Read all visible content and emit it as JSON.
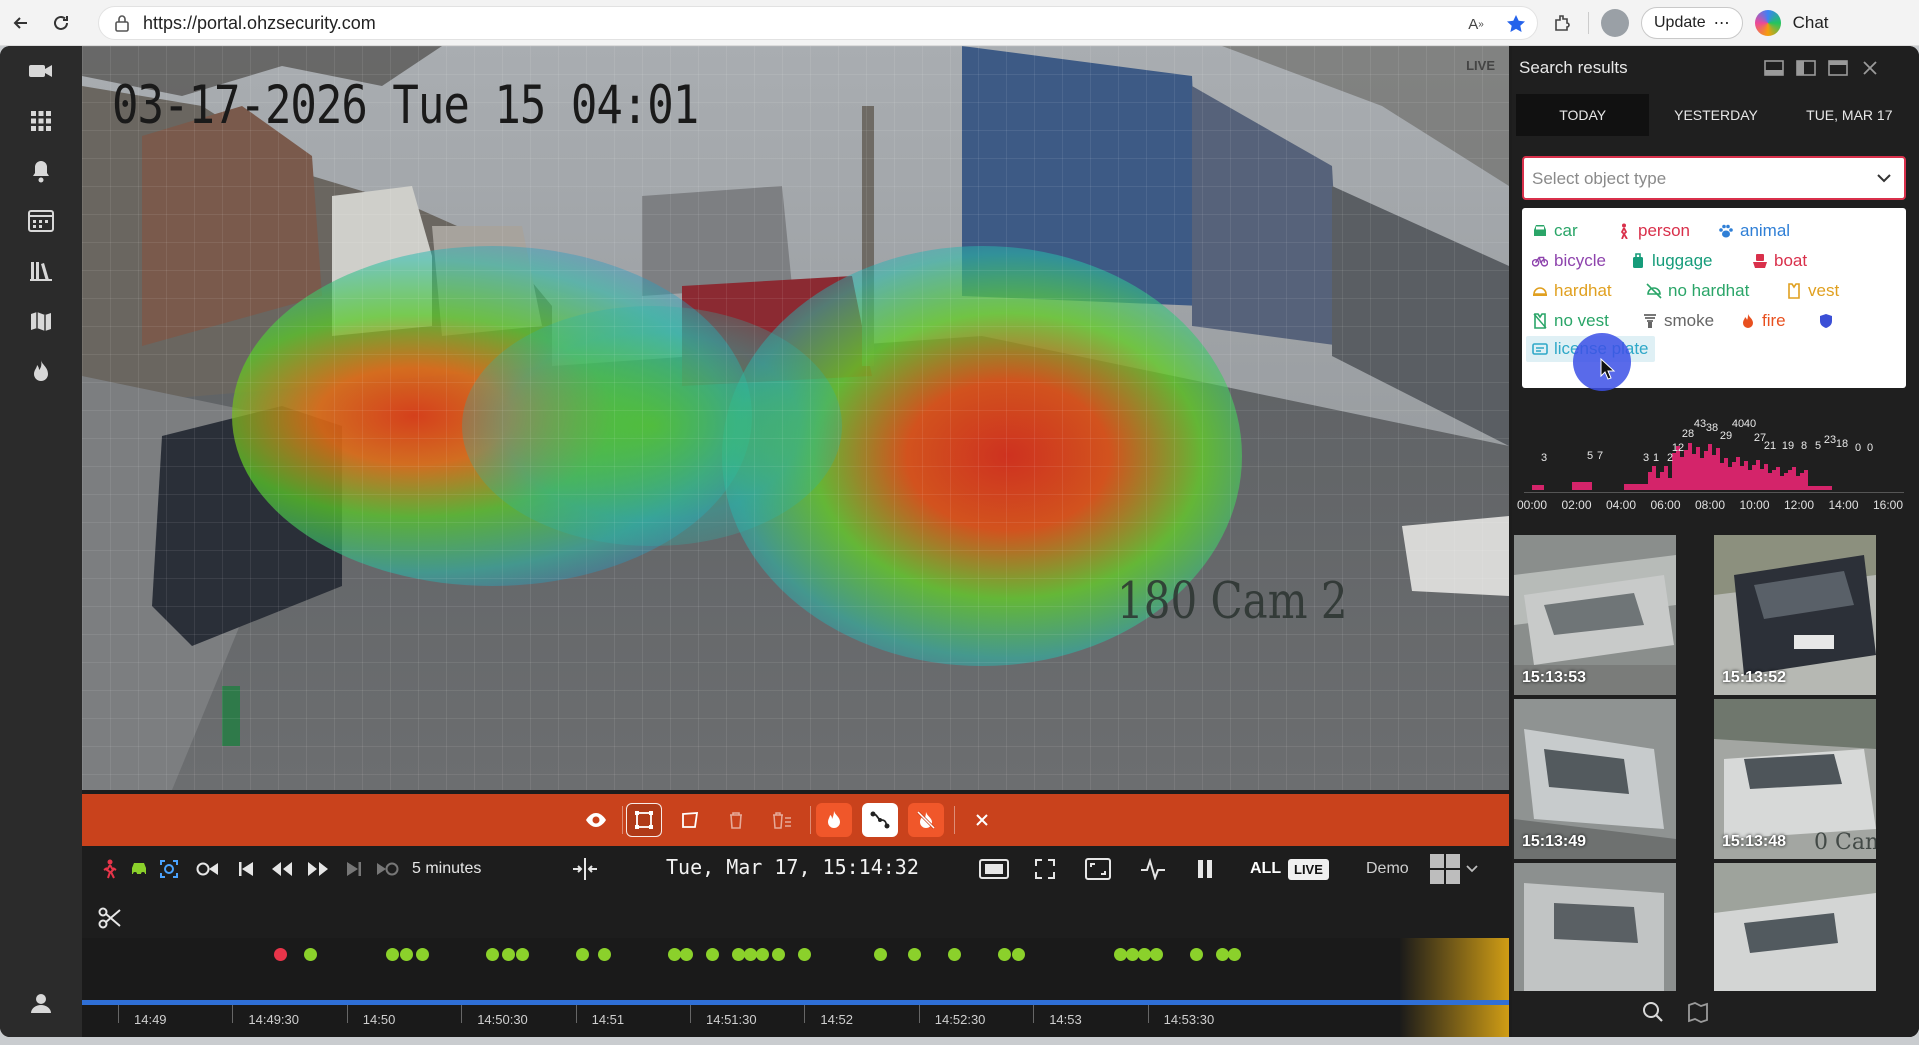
{
  "browser": {
    "url": "https://portal.ohzsecurity.com",
    "update_label": "Update",
    "chat_label": "Chat"
  },
  "video": {
    "osd_timestamp": "03-17-2026 Tue 15 04:01",
    "camera_label": "180 Cam 2",
    "live_label": "LIVE"
  },
  "controls": {
    "interval_label": "5 minutes",
    "current_time": "Tue, Mar 17, 15:14:32",
    "all_label": "ALL",
    "live_label": "LIVE",
    "profile_label": "Demo"
  },
  "timeline": {
    "labels": [
      "14:49",
      "14:49:30",
      "14:50",
      "14:50:30",
      "14:51",
      "14:51:30",
      "14:52",
      "14:52:30",
      "14:53",
      "14:53:30"
    ],
    "event_colors": {
      "person": "#e8354a",
      "car": "#8bd12b"
    }
  },
  "panel": {
    "title": "Search results",
    "tabs": [
      "TODAY",
      "YESTERDAY",
      "TUE, MAR 17"
    ],
    "select_placeholder": "Select object type",
    "object_types": [
      {
        "label": "car",
        "icon": "car-icon",
        "color": "#2aa568"
      },
      {
        "label": "person",
        "icon": "person-icon",
        "color": "#d9304b"
      },
      {
        "label": "animal",
        "icon": "paw-icon",
        "color": "#2f7fd6"
      },
      {
        "label": "bicycle",
        "icon": "bicycle-icon",
        "color": "#8e44ad"
      },
      {
        "label": "luggage",
        "icon": "luggage-icon",
        "color": "#169c7a"
      },
      {
        "label": "boat",
        "icon": "boat-icon",
        "color": "#d9304b"
      },
      {
        "label": "hardhat",
        "icon": "hardhat-icon",
        "color": "#e0a020"
      },
      {
        "label": "no hardhat",
        "icon": "no-hardhat-icon",
        "color": "#2aa568"
      },
      {
        "label": "vest",
        "icon": "vest-icon",
        "color": "#e0a020"
      },
      {
        "label": "no vest",
        "icon": "no-vest-icon",
        "color": "#2aa568"
      },
      {
        "label": "smoke",
        "icon": "smoke-icon",
        "color": "#666666"
      },
      {
        "label": "fire",
        "icon": "fire-icon",
        "color": "#e8501f"
      },
      {
        "label": "",
        "icon": "shield-icon",
        "color": "#3b4fd6"
      },
      {
        "label": "license plate",
        "icon": "license-plate-icon",
        "color": "#2fa8c8"
      }
    ],
    "histogram": {
      "axis_labels": [
        "00:00",
        "02:00",
        "04:00",
        "06:00",
        "08:00",
        "10:00",
        "12:00",
        "14:00",
        "16:00"
      ],
      "value_labels": [
        "3",
        "5",
        "7",
        "3",
        "1",
        "2",
        "12",
        "28",
        "43",
        "38",
        "29",
        "40",
        "40",
        "27",
        "21",
        "19",
        "8",
        "5",
        "23",
        "18",
        "0",
        "0"
      ],
      "bar_color": "#d4246a"
    },
    "thumbnails": [
      {
        "time": "15:13:53"
      },
      {
        "time": "15:13:52"
      },
      {
        "time": "15:13:49"
      },
      {
        "time": "15:13:48"
      }
    ]
  }
}
